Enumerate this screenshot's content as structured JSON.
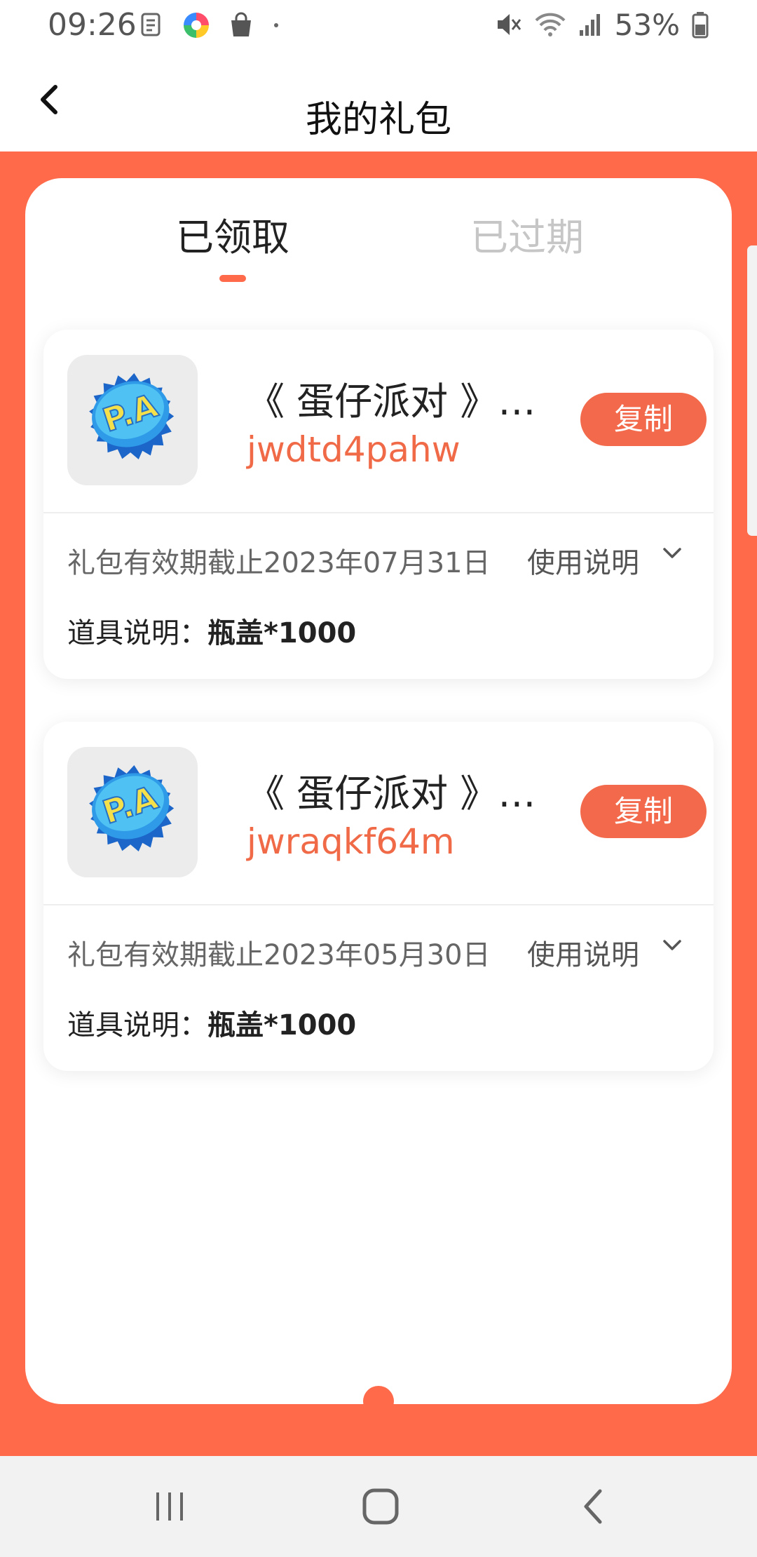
{
  "status_bar": {
    "time": "09:26",
    "battery_text": "53%",
    "icons": [
      "notes-icon",
      "colorful-app-icon",
      "shopping-bag-icon",
      "dot-icon",
      "mute-icon",
      "wifi-icon",
      "signal-icon",
      "battery-icon"
    ]
  },
  "header": {
    "title": "我的礼包",
    "back_icon": "chevron-left-icon"
  },
  "tabs": [
    {
      "label": "已领取",
      "active": true
    },
    {
      "label": "已过期",
      "active": false
    }
  ],
  "gifts": [
    {
      "title": "《 蛋仔派对 》签...",
      "code": "jwdtd4pahw",
      "copy_label": "复制",
      "expiry": "礼包有效期截止2023年07月31日",
      "usage_label": "使用说明",
      "item_prefix": "道具说明：",
      "item_value": "瓶盖*1000"
    },
    {
      "title": "《 蛋仔派对 》签...",
      "code": "jwraqkf64m",
      "copy_label": "复制",
      "expiry": "礼包有效期截止2023年05月30日",
      "usage_label": "使用说明",
      "item_prefix": "道具说明：",
      "item_value": "瓶盖*1000"
    }
  ],
  "nav_bar": {
    "icons": [
      "recent-apps-icon",
      "home-icon",
      "back-icon"
    ]
  },
  "colors": {
    "accent": "#ff6a4a",
    "code_text": "#f06a48",
    "copy_button": "#f26a4b"
  }
}
